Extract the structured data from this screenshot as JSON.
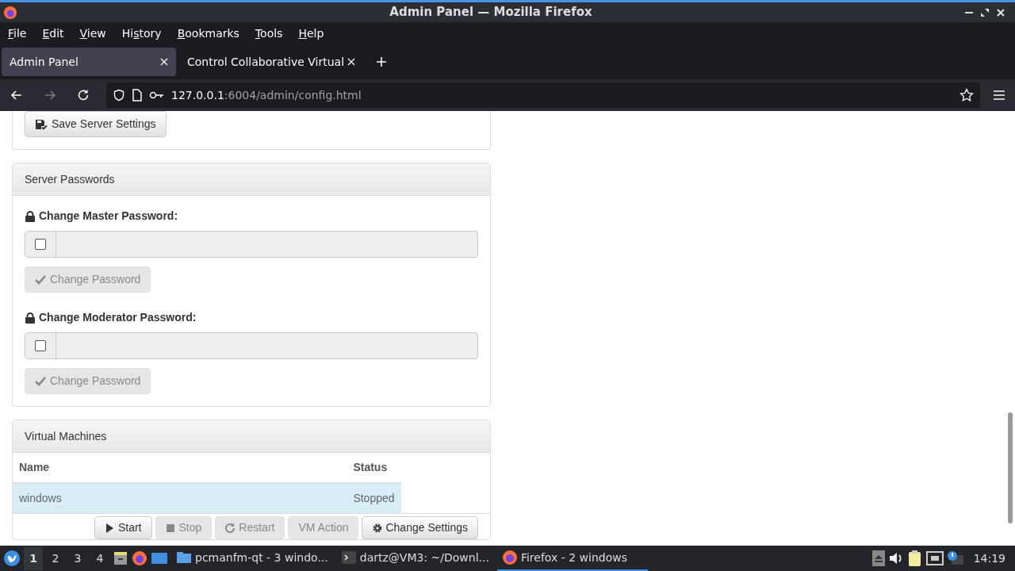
{
  "window": {
    "title": "Admin Panel — Mozilla Firefox"
  },
  "menu": [
    {
      "mnemonic": "F",
      "rest": "ile"
    },
    {
      "mnemonic": "E",
      "rest": "dit"
    },
    {
      "mnemonic": "V",
      "rest": "iew"
    },
    {
      "lead": "Hi",
      "mnemonic": "s",
      "rest": "tory"
    },
    {
      "mnemonic": "B",
      "rest": "ookmarks"
    },
    {
      "mnemonic": "T",
      "rest": "ools"
    },
    {
      "mnemonic": "H",
      "rest": "elp"
    }
  ],
  "tabs": [
    {
      "label": "Admin Panel",
      "selected": true
    },
    {
      "label": "Control Collaborative Virtual",
      "selected": false
    }
  ],
  "nav_buttons": [
    {
      "kind": "back",
      "disabled": false
    },
    {
      "kind": "forward",
      "disabled": true
    },
    {
      "kind": "reload",
      "disabled": false
    }
  ],
  "address": {
    "host": "127.0.0.1",
    "rest": ":6004/admin/config.html"
  },
  "settings_panel": {
    "save_button": "Save Server Settings"
  },
  "passwords_panel": {
    "title": "Server Passwords",
    "fields": [
      {
        "label": "Change Master Password:",
        "checked": false,
        "button": {
          "label": "Change Password",
          "disabled": true
        }
      },
      {
        "label": "Change Moderator Password:",
        "checked": false,
        "button": {
          "label": "Change Password",
          "disabled": true
        }
      }
    ]
  },
  "vm_panel": {
    "title": "Virtual Machines",
    "columns": [
      "Name",
      "Status"
    ],
    "rows": [
      {
        "name": "windows",
        "status": "Stopped",
        "selected": true
      }
    ],
    "actions": [
      {
        "kind": "start",
        "label": "Start",
        "disabled": false
      },
      {
        "kind": "stop",
        "label": "Stop",
        "disabled": true
      },
      {
        "kind": "restart",
        "label": "Restart",
        "disabled": true
      },
      {
        "kind": "menu",
        "label": "VM Action",
        "disabled": true
      },
      {
        "kind": "settings",
        "label": "Change Settings",
        "disabled": false
      }
    ]
  },
  "taskbar": {
    "workspaces": [
      {
        "label": "1",
        "selected": true
      },
      {
        "label": "2",
        "selected": false
      },
      {
        "label": "3",
        "selected": false
      },
      {
        "label": "4",
        "selected": false
      }
    ],
    "tasks": [
      {
        "kind": "folder",
        "label": "pcmanfm-qt - 3 windo...",
        "selected": false
      },
      {
        "kind": "terminal",
        "label": "dartz@VM3: ~/Downl...",
        "selected": false
      },
      {
        "kind": "firefox",
        "label": "Firefox - 2 windows",
        "selected": true
      }
    ],
    "clock": "14:19"
  }
}
